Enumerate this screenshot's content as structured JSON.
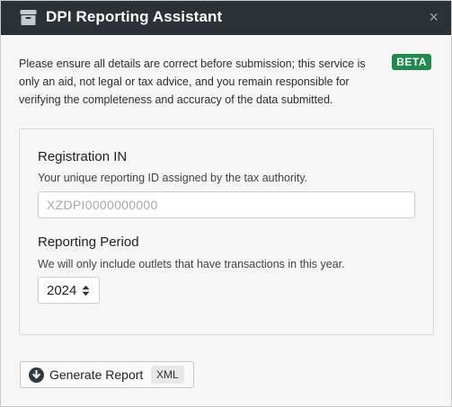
{
  "window": {
    "title": "DPI Reporting Assistant",
    "close_glyph": "×",
    "icon": "archive-box-icon"
  },
  "notice": {
    "text": "Please ensure all details are correct before submission; this service is only an aid, not legal or tax advice, and you remain responsible for verifying the completeness and accuracy of the data submitted.",
    "badge": "BETA",
    "badge_color": "#1e8a4b"
  },
  "form": {
    "registration": {
      "label": "Registration IN",
      "help": "Your unique reporting ID assigned by the tax authority.",
      "value": "",
      "placeholder": "XZDPI0000000000"
    },
    "period": {
      "label": "Reporting Period",
      "help": "We will only include outlets that have transactions in this year.",
      "selected": "2024"
    }
  },
  "actions": {
    "generate_label": "Generate Report",
    "format_tag": "XML",
    "icon": "download-circle-icon"
  }
}
